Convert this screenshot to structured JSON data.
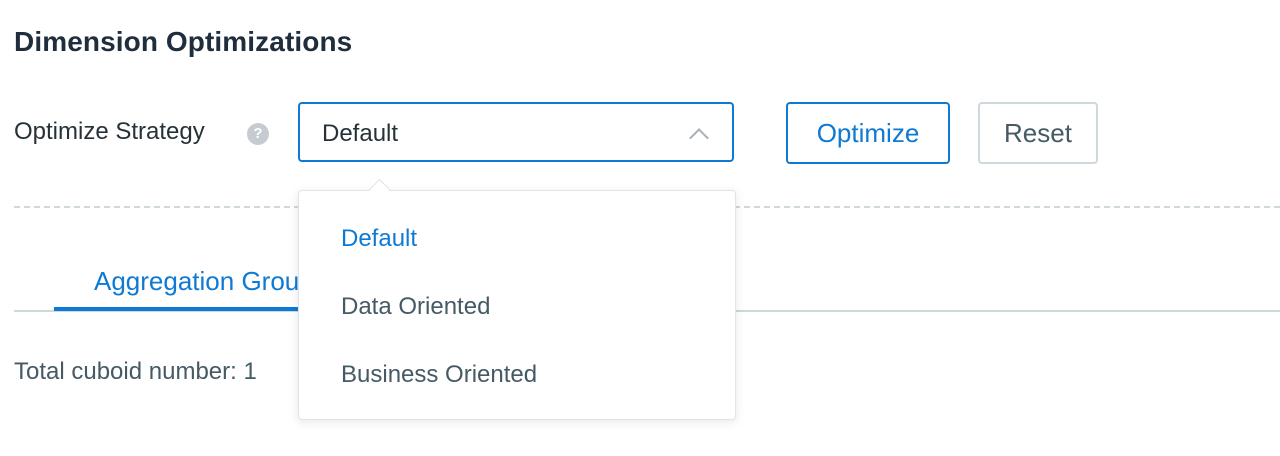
{
  "header": {
    "title": "Dimension Optimizations"
  },
  "strategy": {
    "label": "Optimize Strategy",
    "help_icon": "help-question-icon",
    "selected_value": "Default",
    "chevron_icon": "chevron-up-icon"
  },
  "actions": {
    "optimize_label": "Optimize",
    "reset_label": "Reset"
  },
  "tabs": {
    "active_label": "Aggregation Groups"
  },
  "summary": {
    "total_cuboid_text": "Total cuboid number: 1"
  },
  "dropdown": {
    "options": [
      {
        "label": "Default",
        "selected": true
      },
      {
        "label": "Data Oriented",
        "selected": false
      },
      {
        "label": "Business Oriented",
        "selected": false
      }
    ]
  },
  "colors": {
    "accent": "#0e7ad4",
    "text": "#263238",
    "muted_text": "#455a64",
    "border": "#cfd8dc",
    "help_icon_bg": "#c5cbd1"
  }
}
